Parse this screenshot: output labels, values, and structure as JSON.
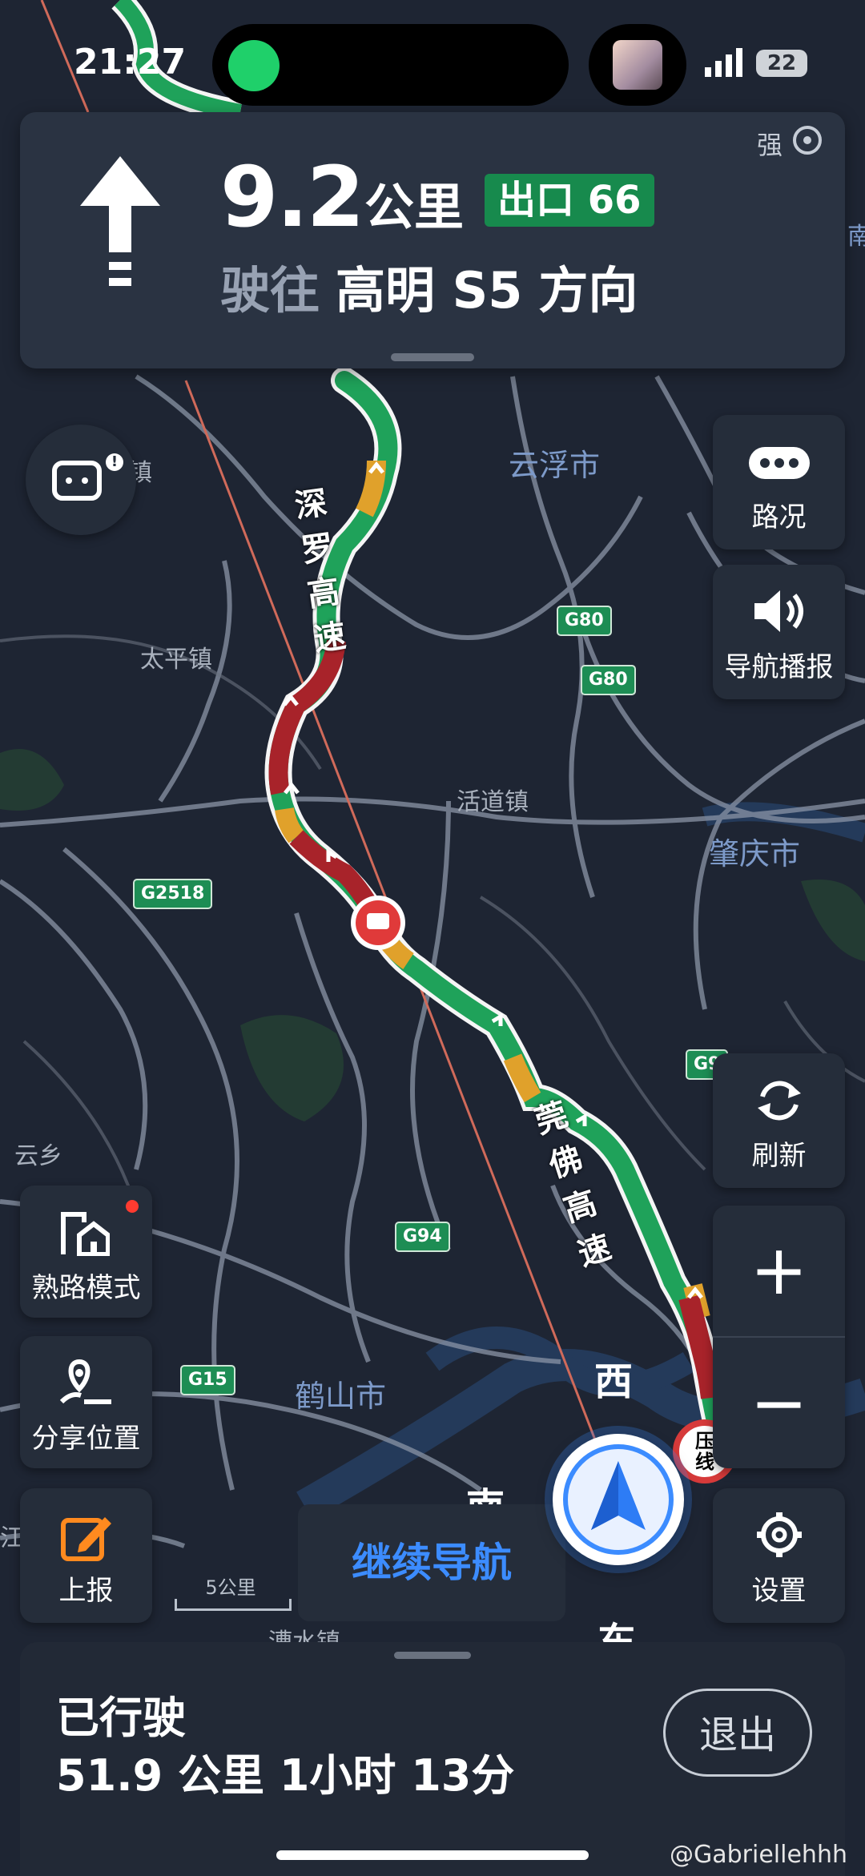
{
  "status_bar": {
    "time": "21:27",
    "battery": "22"
  },
  "guidance": {
    "distance": "9.2",
    "distance_unit": "公里",
    "exit_badge": "出口 66",
    "route_prefix": "驶往",
    "route_road": "高明 S5",
    "route_suffix": "方向",
    "gps_strength": "强",
    "maneuver_icon": "straight-arrow-icon"
  },
  "map": {
    "cities": [
      "云浮市",
      "肇庆市",
      "鹤山市"
    ],
    "towns": [
      "太平镇",
      "活道镇",
      "云乡",
      "漕水镇"
    ],
    "highways": [
      "深罗高速",
      "莞佛高速"
    ],
    "shields": [
      "G80",
      "G80",
      "G2518",
      "G94",
      "G15",
      "G9"
    ],
    "compass": {
      "west": "西",
      "south": "南",
      "east": "东"
    },
    "partial_labels": {
      "edge_right": "南",
      "edge_left": "江",
      "edge_town": "镇",
      "restriction": "压线"
    },
    "scale": "5公里",
    "route_colors": {
      "smooth": "#1fa25a",
      "slow": "#e0a12b",
      "jam": "#a8232a"
    }
  },
  "controls": {
    "traffic": "路况",
    "voice": "导航播报",
    "refresh": "刷新",
    "zoom_in": "+",
    "zoom_out": "−",
    "familiar_mode": "熟路模式",
    "share_location": "分享位置",
    "report": "上报",
    "settings": "设置",
    "continue_nav": "继续导航"
  },
  "trip": {
    "traveled_label": "已行驶",
    "stats": "51.9 公里  1小时 13分",
    "exit": "退出"
  },
  "watermark": "@Gabriellehhh"
}
